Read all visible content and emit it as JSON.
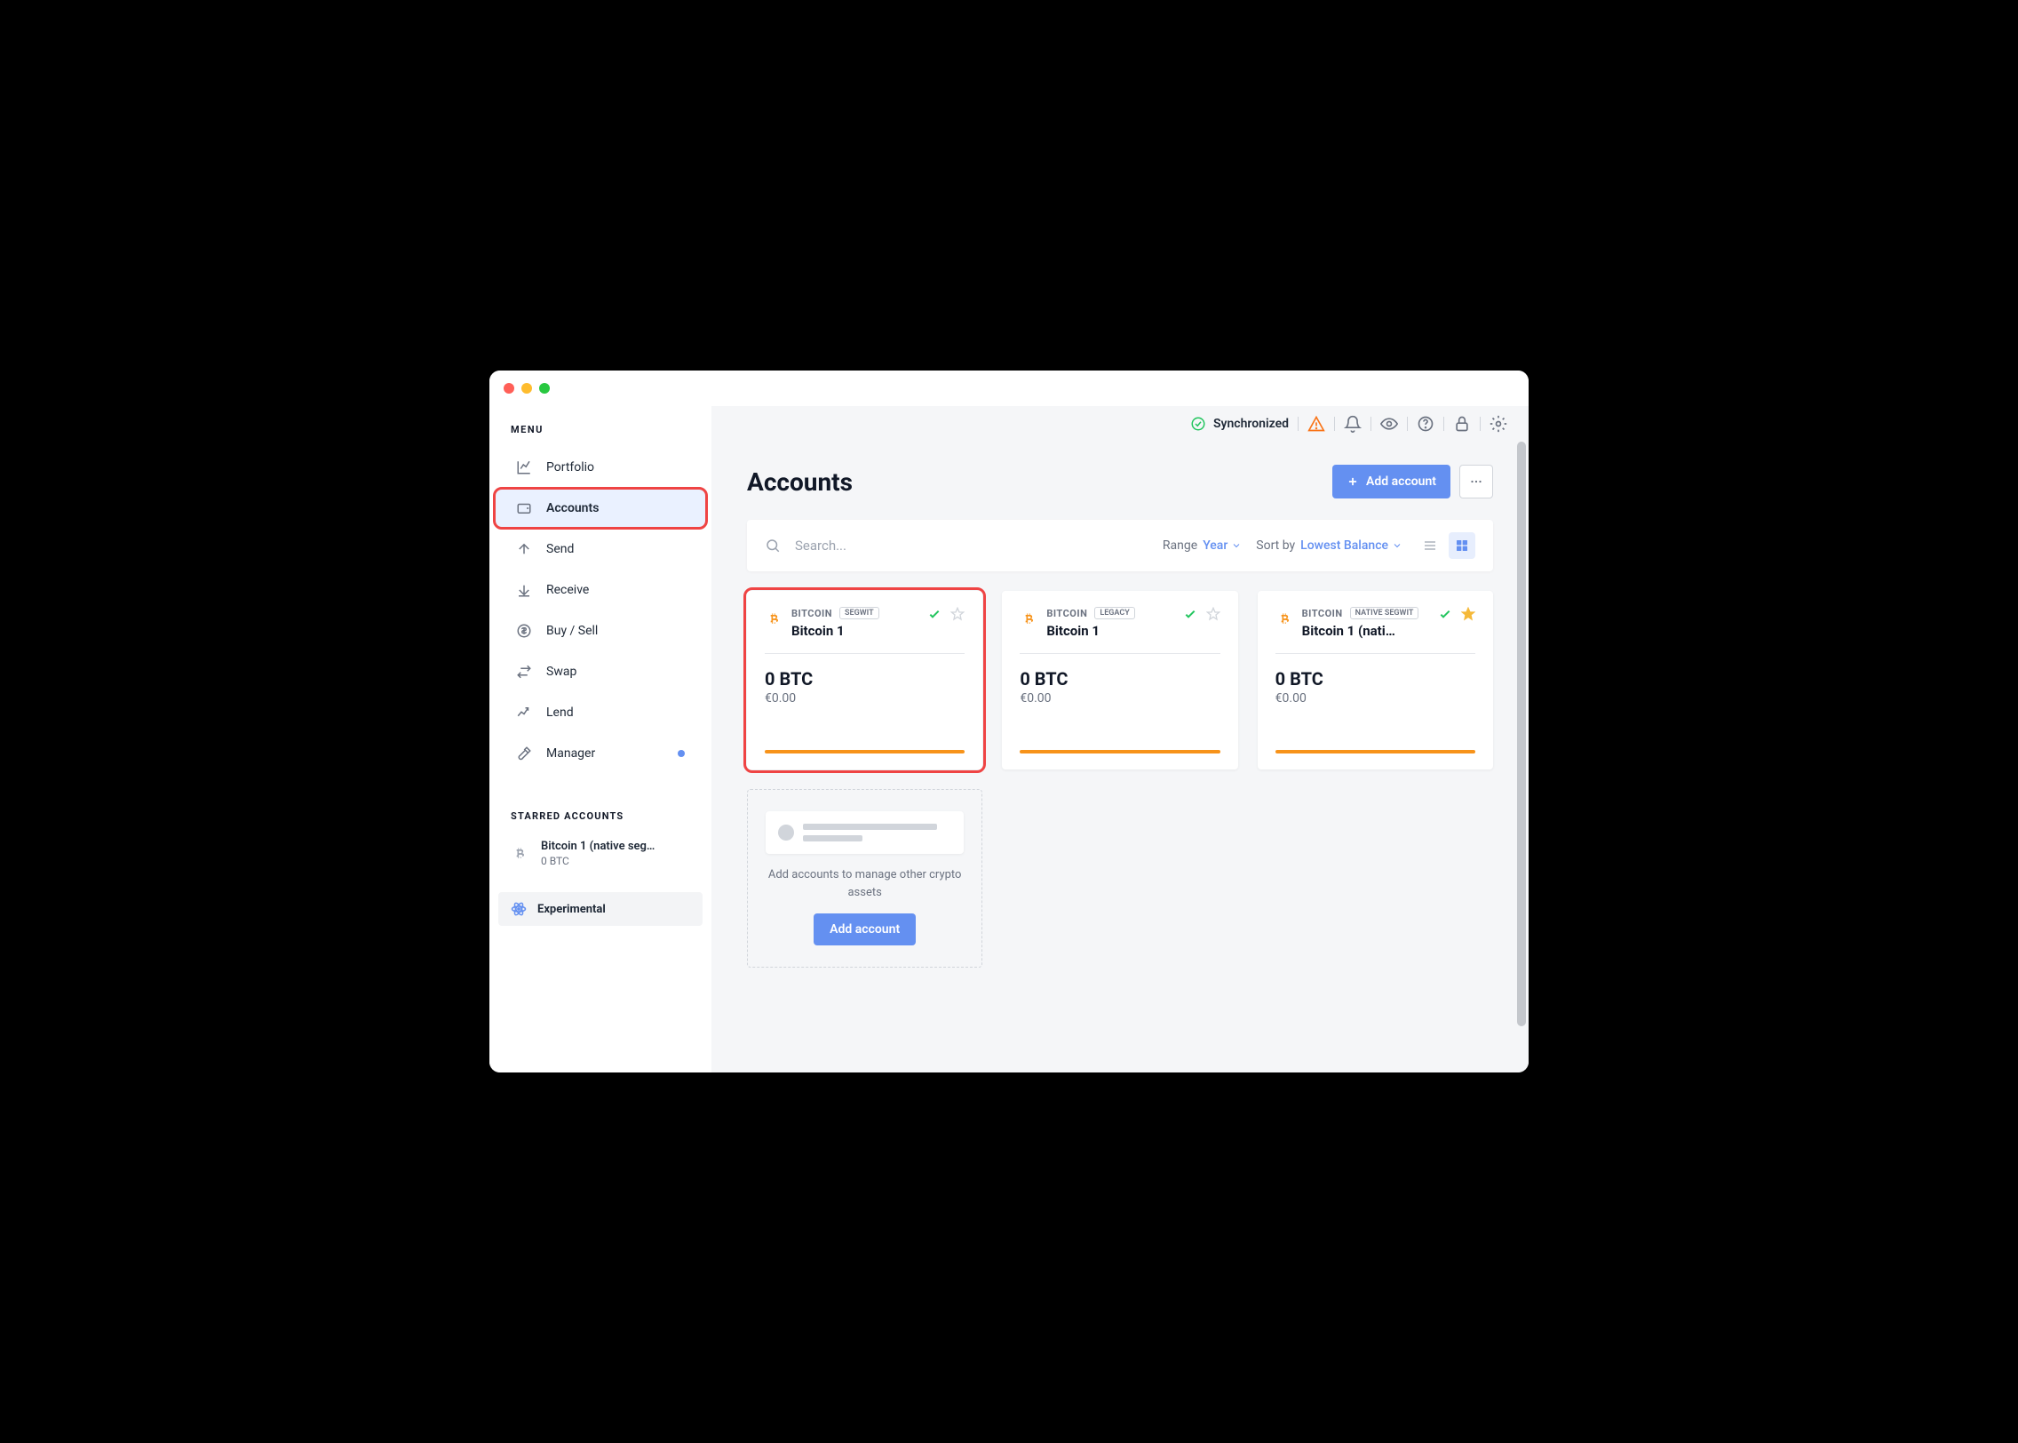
{
  "sidebar": {
    "menuHeader": "MENU",
    "items": [
      {
        "label": "Portfolio",
        "icon": "chart"
      },
      {
        "label": "Accounts",
        "icon": "wallet",
        "active": true,
        "highlighted": true
      },
      {
        "label": "Send",
        "icon": "arrow-up"
      },
      {
        "label": "Receive",
        "icon": "arrow-down"
      },
      {
        "label": "Buy / Sell",
        "icon": "dollar"
      },
      {
        "label": "Swap",
        "icon": "swap"
      },
      {
        "label": "Lend",
        "icon": "growth"
      },
      {
        "label": "Manager",
        "icon": "tools",
        "dot": true
      }
    ],
    "starredHeader": "STARRED ACCOUNTS",
    "starred": [
      {
        "name": "Bitcoin 1 (native seg…",
        "balance": "0 BTC"
      }
    ],
    "experimental": "Experimental"
  },
  "topbar": {
    "syncLabel": "Synchronized"
  },
  "page": {
    "title": "Accounts",
    "addAccountLabel": "Add account"
  },
  "filter": {
    "searchPlaceholder": "Search...",
    "rangeLabel": "Range",
    "rangeValue": "Year",
    "sortLabel": "Sort by",
    "sortValue": "Lowest Balance"
  },
  "accounts": [
    {
      "coin": "BITCOIN",
      "type": "SEGWIT",
      "name": "Bitcoin 1",
      "balance": "0 BTC",
      "fiat": "€0.00",
      "starred": false,
      "highlighted": true
    },
    {
      "coin": "BITCOIN",
      "type": "LEGACY",
      "name": "Bitcoin 1",
      "balance": "0 BTC",
      "fiat": "€0.00",
      "starred": false
    },
    {
      "coin": "BITCOIN",
      "type": "NATIVE SEGWIT",
      "name": "Bitcoin 1 (nati…",
      "balance": "0 BTC",
      "fiat": "€0.00",
      "starred": true
    }
  ],
  "addCard": {
    "text": "Add accounts to manage other crypto assets",
    "button": "Add account"
  }
}
